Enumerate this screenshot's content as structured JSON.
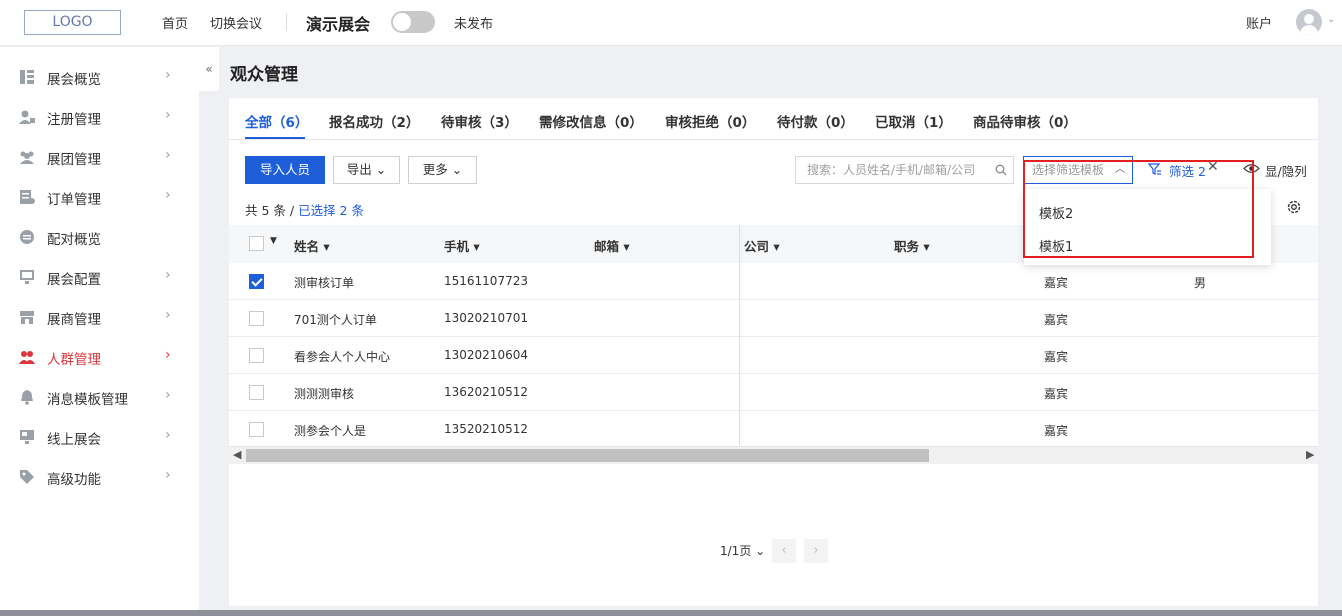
{
  "header": {
    "logo": "LOGO",
    "nav": [
      "首页",
      "切换会议"
    ],
    "expo_title": "演示展会",
    "publish_status": "未发布",
    "account": "账户"
  },
  "sidebar": {
    "items": [
      {
        "label": "展会概览",
        "icon": "overview-icon",
        "has_chevron": true
      },
      {
        "label": "注册管理",
        "icon": "user-register-icon",
        "has_chevron": true
      },
      {
        "label": "展团管理",
        "icon": "group-icon",
        "has_chevron": true
      },
      {
        "label": "订单管理",
        "icon": "order-icon",
        "has_chevron": true
      },
      {
        "label": "配对概览",
        "icon": "match-icon",
        "has_chevron": false
      },
      {
        "label": "展会配置",
        "icon": "config-icon",
        "has_chevron": true
      },
      {
        "label": "展商管理",
        "icon": "exhibitor-icon",
        "has_chevron": true
      },
      {
        "label": "人群管理",
        "icon": "people-icon",
        "has_chevron": true,
        "active": true
      },
      {
        "label": "消息模板管理",
        "icon": "bell-icon",
        "has_chevron": true
      },
      {
        "label": "线上展会",
        "icon": "monitor-icon",
        "has_chevron": true
      },
      {
        "label": "高级功能",
        "icon": "tag-icon",
        "has_chevron": true
      }
    ],
    "collapse": "«"
  },
  "main": {
    "title": "观众管理",
    "tabs": [
      "全部（6）",
      "报名成功（2）",
      "待审核（3）",
      "需修改信息（0）",
      "审核拒绝（0）",
      "待付款（0）",
      "已取消（1）",
      "商品待审核（0）"
    ],
    "toolbar": {
      "import": "导入人员",
      "export": "导出",
      "more": "更多",
      "search_placeholder": "搜索：人员姓名/手机/邮箱/公司",
      "template_placeholder": "选择筛选模板",
      "filter": "筛选 2",
      "show_hide": "显/隐列"
    },
    "count_prefix": "共 5 条 / ",
    "count_selected": "已选择 2 条",
    "columns": [
      "姓名",
      "手机",
      "邮箱",
      "公司",
      "职务"
    ],
    "rows": [
      {
        "name": "测审核订单",
        "phone": "15161107723",
        "role": "嘉宾",
        "gender": "男",
        "checked": true
      },
      {
        "name": "701测个人订单",
        "phone": "13020210701",
        "role": "嘉宾",
        "gender": "",
        "checked": false
      },
      {
        "name": "看参会人个人中心",
        "phone": "13020210604",
        "role": "嘉宾",
        "gender": "",
        "checked": false
      },
      {
        "name": "测测测审核",
        "phone": "13620210512",
        "role": "嘉宾",
        "gender": "",
        "checked": false
      },
      {
        "name": "测参会个人是",
        "phone": "13520210512",
        "role": "嘉宾",
        "gender": "",
        "checked": false
      }
    ],
    "pager": "1/1页"
  },
  "dropdown": {
    "options": [
      "模板2",
      "模板1"
    ]
  },
  "colors": {
    "primary": "#1e5ed8",
    "active_menu": "#d9363e",
    "highlight": "#e0201e"
  }
}
